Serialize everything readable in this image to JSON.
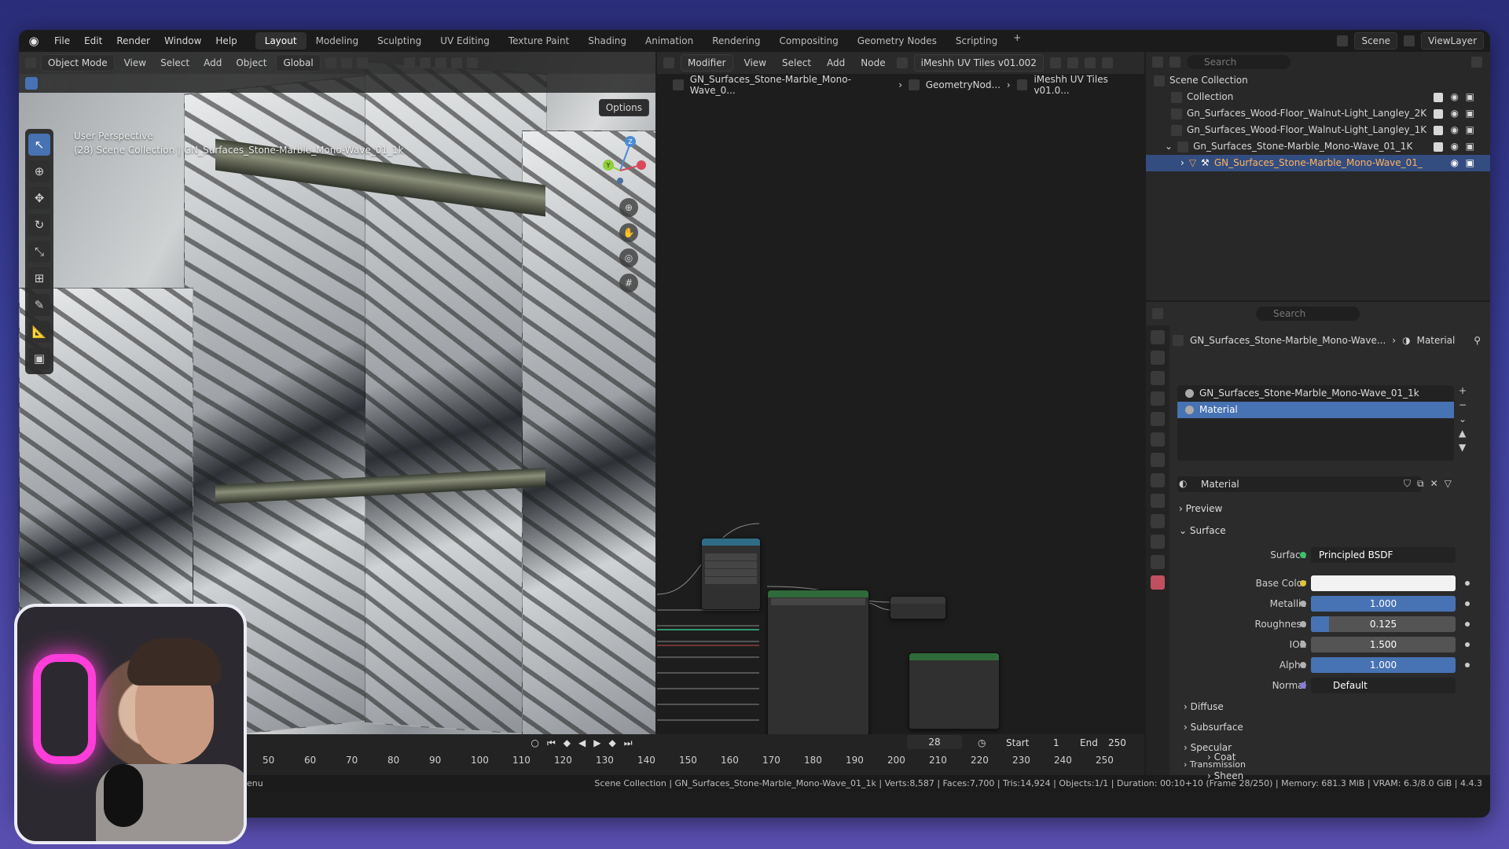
{
  "menubar": {
    "items": [
      "File",
      "Edit",
      "Render",
      "Window",
      "Help"
    ],
    "workspaces": [
      "Layout",
      "Modeling",
      "Sculpting",
      "UV Editing",
      "Texture Paint",
      "Shading",
      "Animation",
      "Rendering",
      "Compositing",
      "Geometry Nodes",
      "Scripting"
    ],
    "active_workspace": "Layout",
    "add_tab": "+",
    "scene": "Scene",
    "view_layer": "ViewLayer"
  },
  "viewport": {
    "mode": "Object Mode",
    "menus": [
      "View",
      "Select",
      "Add",
      "Object"
    ],
    "orientation": "Global",
    "options": "Options",
    "perspective": "User Perspective",
    "context": "(28) Scene Collection | GN_Surfaces_Stone-Marble_Mono-Wave_01_1k",
    "gizmo_labels": {
      "z": "Z",
      "y": "Y"
    }
  },
  "node_editor": {
    "type": "Modifier",
    "menus": [
      "View",
      "Select",
      "Add",
      "Node"
    ],
    "node_tree": "iMeshh UV Tiles v01.002",
    "breadcrumbs": [
      "GN_Surfaces_Stone-Marble_Mono-Wave_0...",
      "GeometryNod...",
      "iMeshh UV Tiles v01.0..."
    ]
  },
  "timeline": {
    "current_frame": "28",
    "start_label": "Start",
    "start": "1",
    "end_label": "End",
    "end": "250",
    "ruler": [
      "50",
      "60",
      "70",
      "80",
      "90",
      "100",
      "110",
      "120",
      "130",
      "140",
      "150",
      "160",
      "170",
      "180",
      "190",
      "200",
      "210",
      "220",
      "230",
      "240",
      "250"
    ]
  },
  "outliner": {
    "search_placeholder": "Search",
    "rows": [
      "Scene Collection",
      "Collection",
      "Gn_Surfaces_Wood-Floor_Walnut-Light_Langley_2K",
      "Gn_Surfaces_Wood-Floor_Walnut-Light_Langley_1K",
      "Gn_Surfaces_Stone-Marble_Mono-Wave_01_1K",
      "GN_Surfaces_Stone-Marble_Mono-Wave_01_"
    ]
  },
  "properties": {
    "search_placeholder": "Search",
    "breadcrumb_object": "GN_Surfaces_Stone-Marble_Mono-Wave...",
    "breadcrumb_tab": "Material",
    "slots": [
      "GN_Surfaces_Stone-Marble_Mono-Wave_01_1k",
      "Material"
    ],
    "material_name": "Material",
    "panels": {
      "preview": "Preview",
      "surface": "Surface"
    },
    "surface_label": "Surface",
    "surface_value": "Principled BSDF",
    "rows": [
      {
        "label": "Base Color",
        "value": ""
      },
      {
        "label": "Metallic",
        "value": "1.000"
      },
      {
        "label": "Roughness",
        "value": "0.125"
      },
      {
        "label": "IOR",
        "value": "1.500"
      },
      {
        "label": "Alpha",
        "value": "1.000"
      },
      {
        "label": "Normal",
        "value": "Default"
      }
    ],
    "fill_fractions": {
      "metallic": 1.0,
      "roughness": 0.125,
      "alpha": 1.0
    },
    "subpanels": [
      "Diffuse",
      "Subsurface",
      "Specular",
      "Transmission",
      "Coat",
      "Sheen"
    ]
  },
  "statusbar": {
    "left": "enu",
    "right": "Scene Collection | GN_Surfaces_Stone-Marble_Mono-Wave_01_1k | Verts:8,587 | Faces:7,700 | Tris:14,924 | Objects:1/1 | Duration: 00:10+10 (Frame 28/250) | Memory: 681.3 MiB | VRAM: 6.3/8.0 GiB | 4.4.3"
  },
  "colors": {
    "accent": "#4772b3",
    "selection": "#334d80",
    "material_tab": "#c05060"
  }
}
